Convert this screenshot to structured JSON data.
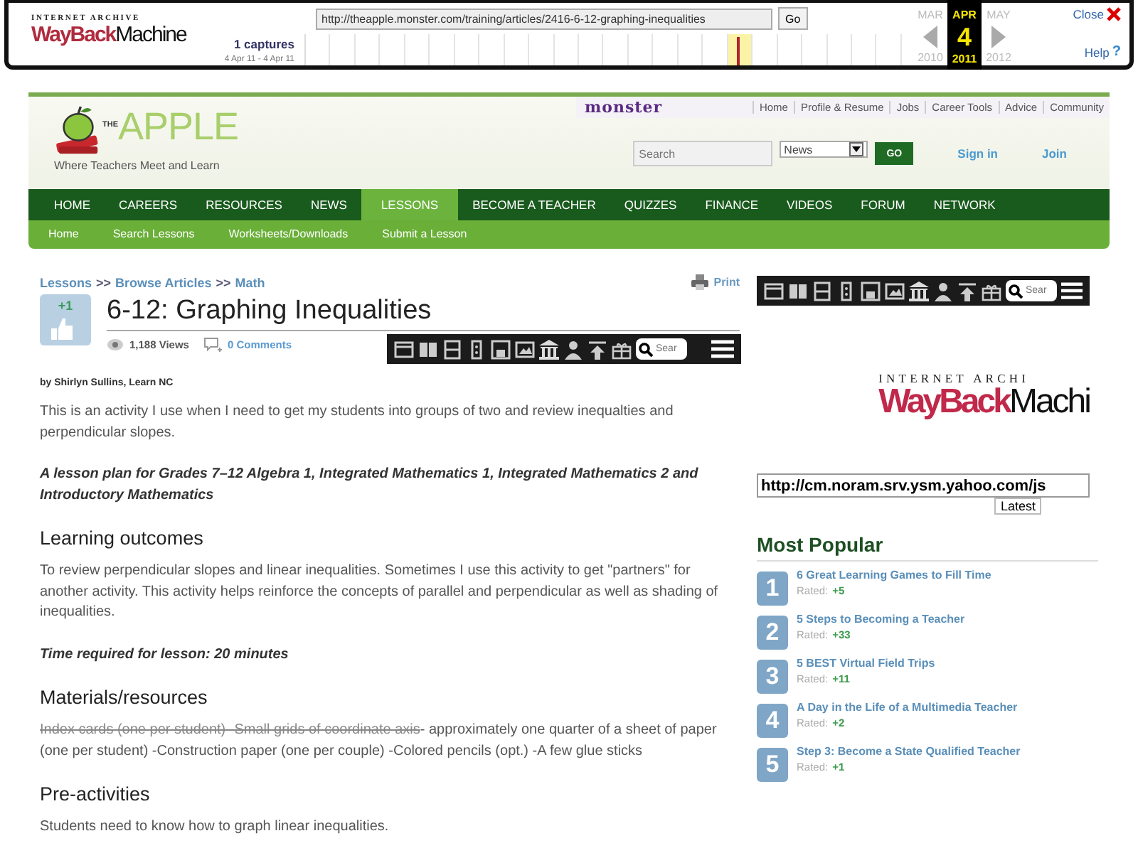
{
  "wayback_bar": {
    "logo": {
      "top": "INTERNET ARCHIVE",
      "word_1": "WayBack",
      "word_2": "Machine"
    },
    "url": "http://theapple.monster.com/training/articles/2416-6-12-graphing-inequalities",
    "go_button": "Go",
    "captures": "1 captures",
    "capture_range": "4 Apr 11 - 4 Apr 11",
    "calendar": {
      "day": "4",
      "months": [
        {
          "month": "MAR",
          "year": "2010",
          "selected": false
        },
        {
          "month": "APR",
          "year": "2011",
          "selected": true
        },
        {
          "month": "MAY",
          "year": "2012",
          "selected": false
        }
      ]
    },
    "close": "Close",
    "help": "Help",
    "help_icon": "?"
  },
  "site_header": {
    "logo": {
      "small": "THE",
      "name": "APPLE",
      "tagline": "Where Teachers Meet and Learn"
    },
    "brand": "monster",
    "top_links": [
      "Home",
      "Profile & Resume",
      "Jobs",
      "Career Tools",
      "Advice",
      "Community"
    ],
    "search": {
      "placeholder": "Search"
    },
    "category": "News",
    "go_button": "GO",
    "sign_in": "Sign in",
    "join": "Join"
  },
  "main_nav": [
    {
      "label": "HOME",
      "selected": false
    },
    {
      "label": "CAREERS",
      "selected": false
    },
    {
      "label": "RESOURCES",
      "selected": false
    },
    {
      "label": "NEWS",
      "selected": false
    },
    {
      "label": "LESSONS",
      "selected": true
    },
    {
      "label": "BECOME A TEACHER",
      "selected": false
    },
    {
      "label": "QUIZZES",
      "selected": false
    },
    {
      "label": "FINANCE",
      "selected": false
    },
    {
      "label": "VIDEOS",
      "selected": false
    },
    {
      "label": "FORUM",
      "selected": false
    },
    {
      "label": "NETWORK",
      "selected": false
    }
  ],
  "sub_nav": [
    "Home",
    "Search Lessons",
    "Worksheets/Downloads",
    "Submit a Lesson"
  ],
  "article": {
    "breadcrumb": [
      {
        "kind": "link",
        "text": "Lessons"
      },
      {
        "kind": "separator",
        "text": ">>"
      },
      {
        "kind": "link",
        "text": "Browse Articles"
      },
      {
        "kind": "separator",
        "text": ">>"
      },
      {
        "kind": "link",
        "text": "Math"
      }
    ],
    "print": "Print",
    "vote": "+1",
    "title": "6-12: Graphing Inequalities",
    "views": "1,188 Views",
    "comments": "0 Comments",
    "toolbar": {
      "placeholder": "Sear"
    },
    "body": [
      {
        "kind": "byline",
        "text": "by Shirlyn Sullins, Learn NC"
      },
      {
        "kind": "text",
        "text": "This is an activity I use when I need to get my students into groups of two and review inequalties and perpendicular slopes."
      },
      {
        "kind": "emphasis",
        "text": "A lesson plan for Grades 7–12 Algebra 1, Integrated Mathematics 1, Integrated Mathematics 2 and Introductory Mathematics"
      },
      {
        "kind": "heading",
        "text": "Learning outcomes"
      },
      {
        "kind": "text",
        "text": "To review perpendicular slopes and linear inequalities. Sometimes I use this activity to get \"partners\" for another activity. This activity helps reinforce the concepts of parallel and perpendicular as well as shading of inequalities."
      },
      {
        "kind": "emphasis",
        "text": "Time required for lesson: 20 minutes"
      },
      {
        "kind": "heading",
        "text": "Materials/resources"
      },
      {
        "kind": "struck",
        "struck": "Index cards (one per student) -Small grids of coordinate axis",
        "text": "- approximately one quarter of a sheet of paper (one per student) -Construction paper (one per couple) -Colored pencils (opt.) -A few glue sticks"
      },
      {
        "kind": "heading",
        "text": "Pre-activities"
      },
      {
        "kind": "text",
        "text": "Students need to know how to graph linear inequalities."
      }
    ]
  },
  "sidebar": {
    "toolbar": {
      "placeholder": "Sear"
    },
    "archive_logo": {
      "top": "INTERNET ARCHI",
      "word_1": "WayBack",
      "word_2": "Machi"
    },
    "url_field": {
      "value": "http://cm.noram.srv.ysm.yahoo.com/js"
    },
    "latest_button": "Latest",
    "most_popular": {
      "title": "Most Popular",
      "items": [
        {
          "number": "1",
          "title": "6 Great Learning Games to Fill Time",
          "rated_label": "Rated:",
          "rating": "+5"
        },
        {
          "number": "2",
          "title": "5 Steps to Becoming a Teacher",
          "rated_label": "Rated:",
          "rating": "+33"
        },
        {
          "number": "3",
          "title": "5 BEST Virtual Field Trips",
          "rated_label": "Rated:",
          "rating": "+11"
        },
        {
          "number": "4",
          "title": "A Day in the Life of a Multimedia Teacher",
          "rated_label": "Rated:",
          "rating": "+2"
        },
        {
          "number": "5",
          "title": "Step 3: Become a State Qualified Teacher",
          "rated_label": "Rated:",
          "rating": "+1"
        }
      ]
    }
  }
}
